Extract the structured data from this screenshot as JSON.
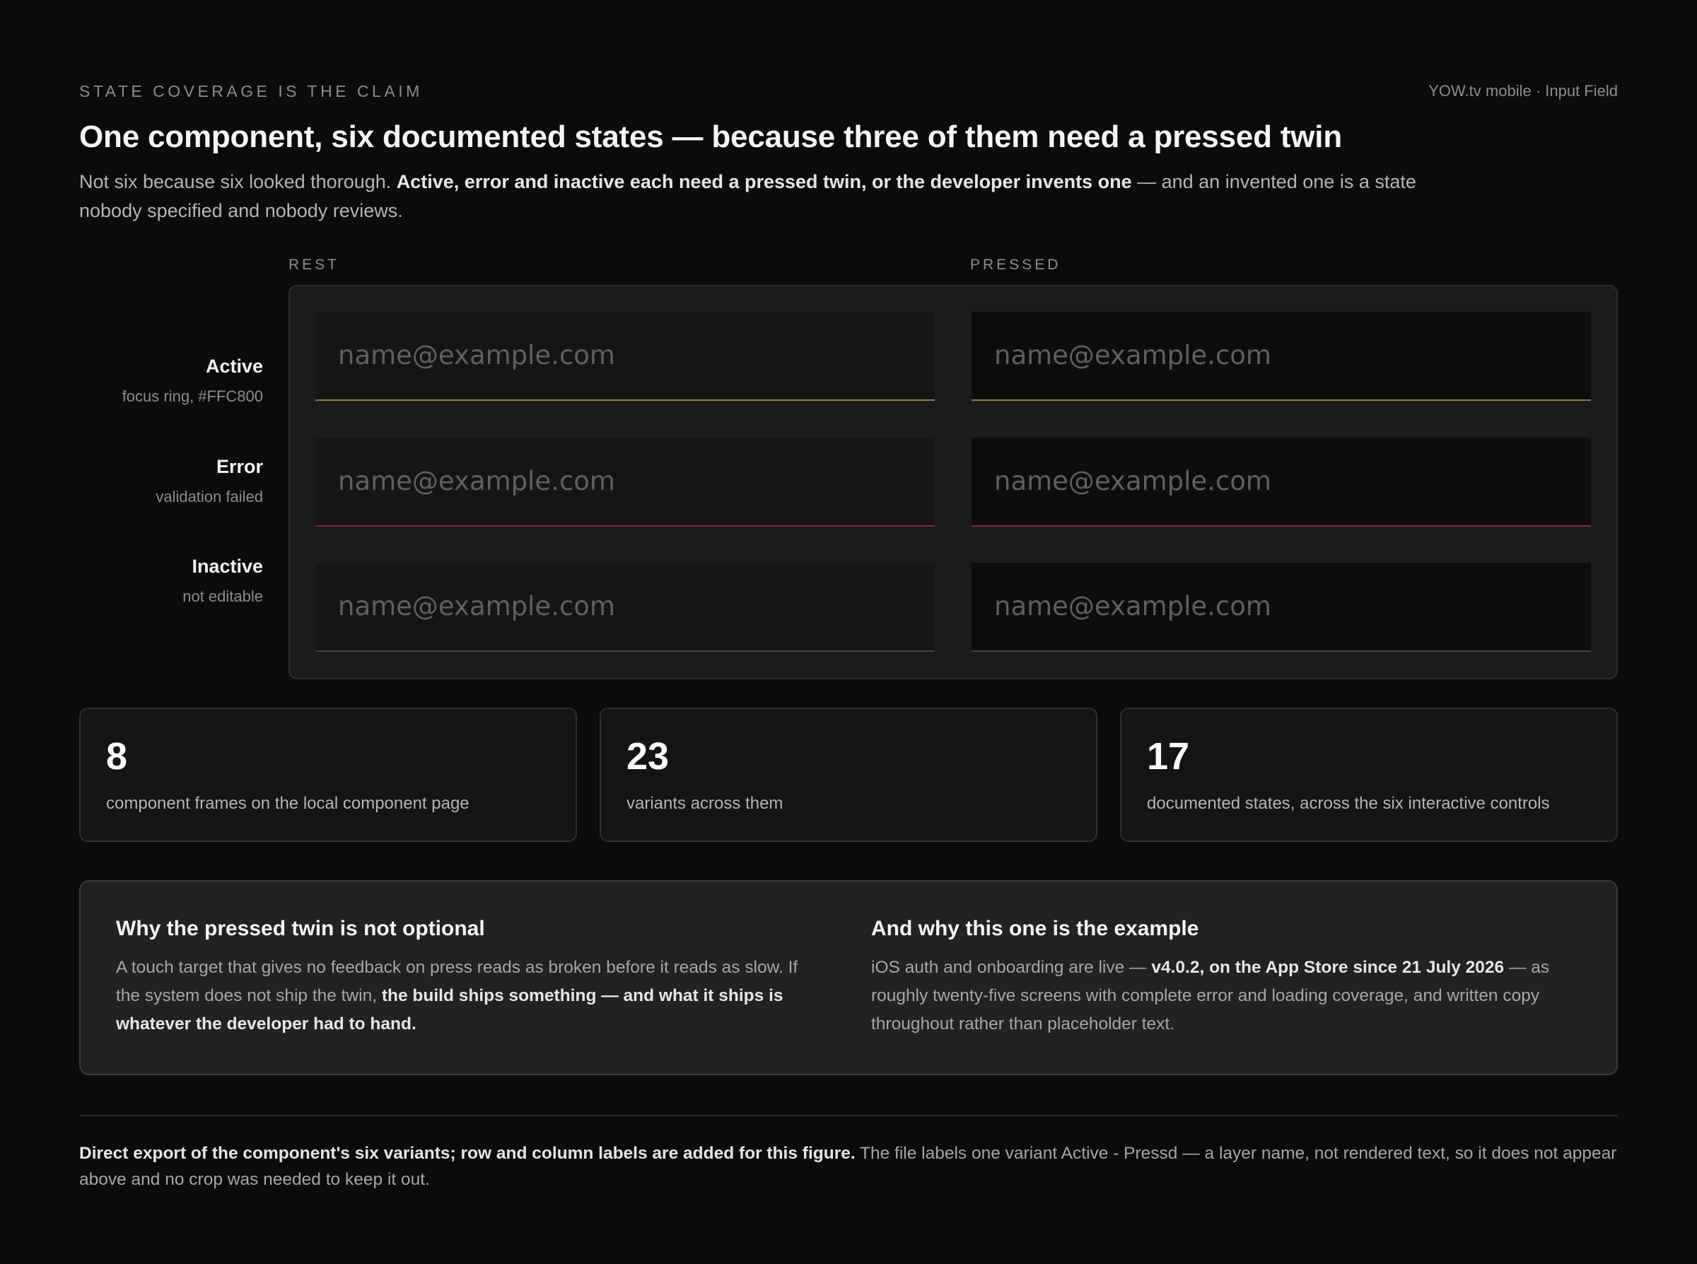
{
  "header": {
    "eyebrow": "STATE COVERAGE IS THE CLAIM",
    "meta": "YOW.tv mobile · Input Field",
    "title": "One component, six documented states — because three of them need a pressed twin",
    "lede_plain_1": "Not six because six looked thorough. ",
    "lede_bold": "Active, error and inactive each need a pressed twin, or the developer invents one",
    "lede_plain_2": " — and an invented one is a state nobody specified and nobody reviews."
  },
  "columns": {
    "rest": "REST",
    "pressed": "PRESSED"
  },
  "rows": [
    {
      "name": "Active",
      "note": "focus ring, #FFC800",
      "state": "active"
    },
    {
      "name": "Error",
      "note": "validation failed",
      "state": "error"
    },
    {
      "name": "Inactive",
      "note": "not editable",
      "state": "inactive"
    }
  ],
  "field": {
    "placeholder": "name@example.com"
  },
  "colors": {
    "focus_ring": "#FFC800",
    "error_line": "#8a2434",
    "background": "#0b0b0b"
  },
  "stats": [
    {
      "value": "8",
      "label": "component frames on the local component page"
    },
    {
      "value": "23",
      "label": "variants across them"
    },
    {
      "value": "17",
      "label": "documented states, across the six interactive controls"
    }
  ],
  "why": {
    "left": {
      "title": "Why the pressed twin is not optional",
      "plain": "A touch target that gives no feedback on press reads as broken before it reads as slow. If the system does not ship the twin, ",
      "bold": "the build ships something — and what it ships is whatever the developer had to hand."
    },
    "right": {
      "title": "And why this one is the example",
      "plain_1": "iOS auth and onboarding are live — ",
      "bold": "v4.0.2, on the App Store since 21 July 2026",
      "plain_2": " — as roughly twenty-five screens with complete error and loading coverage, and written copy throughout rather than placeholder text."
    }
  },
  "footnote": {
    "bold": "Direct export of the component's six variants; row and column labels are added for this figure.",
    "plain": " The file labels one variant Active - Pressd — a layer name, not rendered text, so it does not appear above and no crop was needed to keep it out."
  }
}
